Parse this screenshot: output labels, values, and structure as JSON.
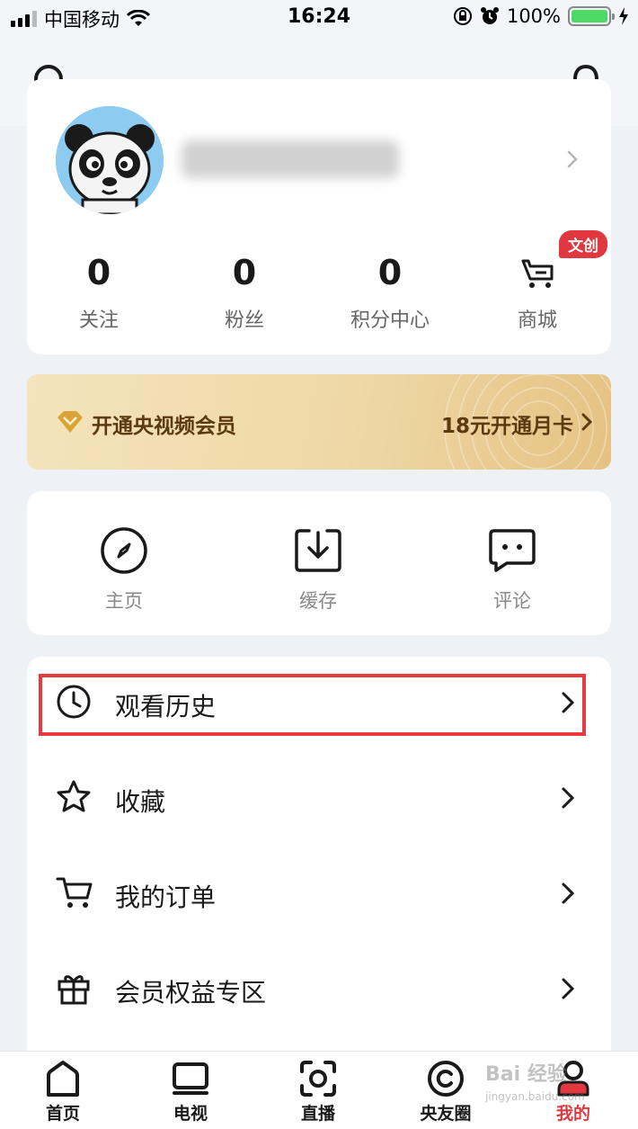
{
  "status_bar": {
    "carrier": "中国移动",
    "time": "16:24",
    "battery": "100%",
    "battery_color": "#4cd964"
  },
  "header": {
    "search_icon": "search-icon",
    "bell_icon": "bell-icon"
  },
  "profile": {
    "avatar": "panda-avatar",
    "username": "",
    "stats": [
      {
        "value": "0",
        "label": "关注"
      },
      {
        "value": "0",
        "label": "粉丝"
      },
      {
        "value": "0",
        "label": "积分中心"
      }
    ],
    "shop": {
      "label": "商城",
      "badge": "文创"
    }
  },
  "vip": {
    "title": "开通央视频会员",
    "cta": "18元开通月卡"
  },
  "quick_actions": [
    {
      "label": "主页",
      "icon": "compass-icon"
    },
    {
      "label": "缓存",
      "icon": "download-icon"
    },
    {
      "label": "评论",
      "icon": "comment-icon"
    }
  ],
  "menu": [
    {
      "label": "观看历史",
      "icon": "clock-icon"
    },
    {
      "label": "收藏",
      "icon": "star-icon"
    },
    {
      "label": "我的订单",
      "icon": "cart-icon"
    },
    {
      "label": "会员权益专区",
      "icon": "gift-icon"
    }
  ],
  "tabs": [
    {
      "label": "首页",
      "icon": "home-icon"
    },
    {
      "label": "电视",
      "icon": "tv-icon"
    },
    {
      "label": "直播",
      "icon": "live-icon"
    },
    {
      "label": "央友圈",
      "icon": "circle-icon"
    },
    {
      "label": "我的",
      "icon": "user-icon",
      "active": true
    }
  ],
  "colors": {
    "accent": "#e0383e",
    "highlight": "#e8393e",
    "vip_text": "#5b3a10"
  },
  "watermark": {
    "brand": "Bai 经验",
    "url": "jingyan.baidu.com"
  }
}
